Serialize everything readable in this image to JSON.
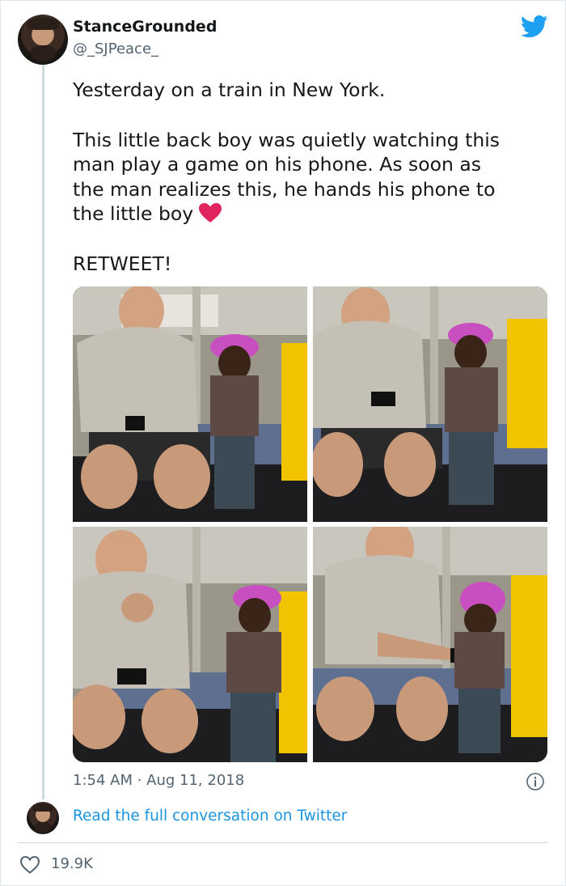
{
  "author": {
    "display_name": "StanceGrounded",
    "handle": "@_SJPeace_"
  },
  "tweet": {
    "paragraphs": [
      "Yesterday on a train in New York.",
      "This little back boy was quietly watching this\nman play a game on his phone. As soon as\nthe man realizes this, he hands his phone to\nthe little boy",
      "RETWEET!"
    ],
    "emoji": "red-heart-emoji",
    "timestamp": "1:54 AM · Aug 11, 2018"
  },
  "media": {
    "photos": [
      {
        "icon": "photo-man-looking-at-phone"
      },
      {
        "icon": "photo-man-playing-boy-watching"
      },
      {
        "icon": "photo-boy-looking-at-man"
      },
      {
        "icon": "photo-man-hands-phone-to-boy"
      }
    ]
  },
  "footer": {
    "read_link": "Read the full conversation on Twitter",
    "like_count": "19.9K"
  },
  "colors": {
    "link": "#1b95e0",
    "twitter_blue": "#1da1f2",
    "heart": "#e0245e",
    "muted": "#536471"
  }
}
